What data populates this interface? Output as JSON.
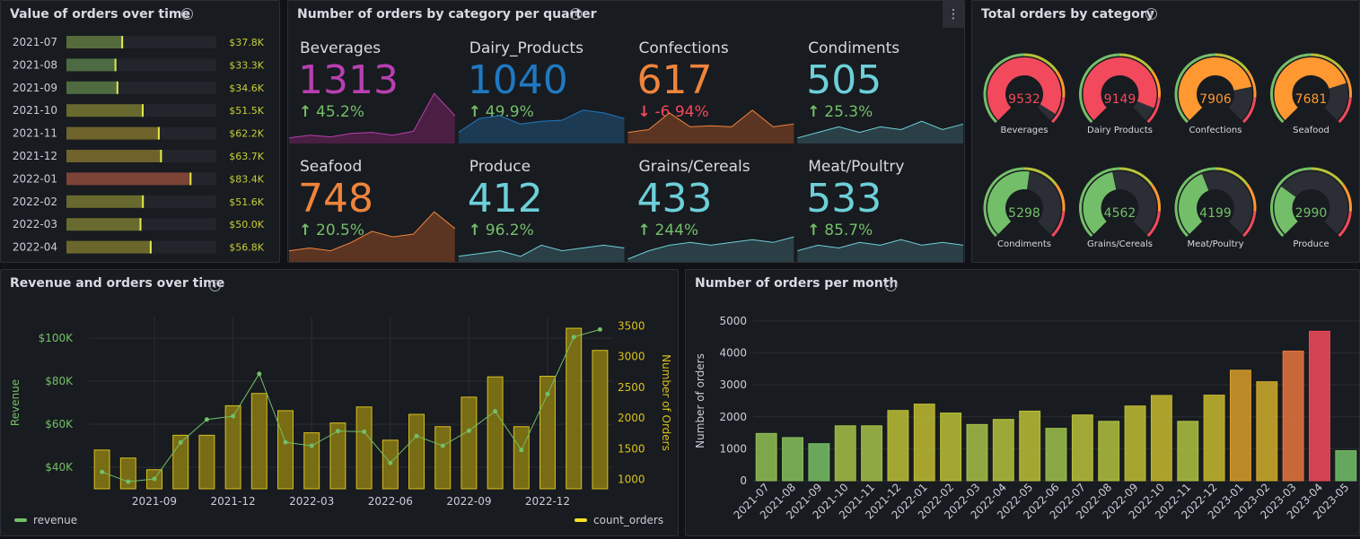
{
  "colors": {
    "green": "#73bf69",
    "yellow": "#fade2a",
    "orange": "#ff9830",
    "red": "#f2495c",
    "gold": "#b8a21c"
  },
  "panel1": {
    "title": "Value of orders over time",
    "rows": [
      {
        "label": "2021-07",
        "value": "$37.8K",
        "num": 37.8
      },
      {
        "label": "2021-08",
        "value": "$33.3K",
        "num": 33.3
      },
      {
        "label": "2021-09",
        "value": "$34.6K",
        "num": 34.6
      },
      {
        "label": "2021-10",
        "value": "$51.5K",
        "num": 51.5
      },
      {
        "label": "2021-11",
        "value": "$62.2K",
        "num": 62.2
      },
      {
        "label": "2021-12",
        "value": "$63.7K",
        "num": 63.7
      },
      {
        "label": "2022-01",
        "value": "$83.4K",
        "num": 83.4
      },
      {
        "label": "2022-02",
        "value": "$51.6K",
        "num": 51.6
      },
      {
        "label": "2022-03",
        "value": "$50.0K",
        "num": 50.0
      },
      {
        "label": "2022-04",
        "value": "$56.8K",
        "num": 56.8
      }
    ]
  },
  "panel2": {
    "title": "Number of orders by category per quarter",
    "stats": [
      {
        "name": "Beverages",
        "value": "1313",
        "change": "45.2%",
        "dir": "up",
        "color": "#b83fb0",
        "fill": "#4a1f43",
        "spark": [
          0.1,
          0.15,
          0.12,
          0.18,
          0.2,
          0.15,
          0.22,
          0.9,
          0.5
        ]
      },
      {
        "name": "Dairy_Products",
        "value": "1040",
        "change": "49.9%",
        "dir": "up",
        "color": "#1f78c1",
        "fill": "#1c3a52",
        "spark": [
          0.2,
          0.45,
          0.5,
          0.35,
          0.4,
          0.42,
          0.6,
          0.55,
          0.45
        ]
      },
      {
        "name": "Confections",
        "value": "617",
        "change": "-6.94%",
        "dir": "down",
        "color": "#ef843c",
        "fill": "#5c3422",
        "spark": [
          0.2,
          0.25,
          0.55,
          0.3,
          0.32,
          0.3,
          0.6,
          0.3,
          0.35
        ]
      },
      {
        "name": "Condiments",
        "value": "505",
        "change": "25.3%",
        "dir": "up",
        "color": "#6ccfd9",
        "fill": "#2b3f47",
        "spark": [
          0.1,
          0.2,
          0.3,
          0.2,
          0.3,
          0.25,
          0.4,
          0.25,
          0.35
        ]
      },
      {
        "name": "Seafood",
        "value": "748",
        "change": "20.5%",
        "dir": "up",
        "color": "#ef843c",
        "fill": "#5c3422",
        "spark": [
          0.2,
          0.25,
          0.2,
          0.35,
          0.55,
          0.45,
          0.5,
          0.9,
          0.6
        ]
      },
      {
        "name": "Produce",
        "value": "412",
        "change": "96.2%",
        "dir": "up",
        "color": "#6ccfd9",
        "fill": "#2b3f47",
        "spark": [
          0.1,
          0.15,
          0.2,
          0.1,
          0.3,
          0.2,
          0.25,
          0.3,
          0.25
        ]
      },
      {
        "name": "Grains/Cereals",
        "value": "433",
        "change": "244%",
        "dir": "up",
        "color": "#6ccfd9",
        "fill": "#2b3f47",
        "spark": [
          0.05,
          0.2,
          0.3,
          0.35,
          0.3,
          0.35,
          0.4,
          0.35,
          0.45
        ]
      },
      {
        "name": "Meat/Poultry",
        "value": "533",
        "change": "85.7%",
        "dir": "up",
        "color": "#6ccfd9",
        "fill": "#2b3f47",
        "spark": [
          0.2,
          0.3,
          0.25,
          0.35,
          0.3,
          0.4,
          0.3,
          0.35,
          0.3
        ]
      }
    ],
    "menu_icon": "kebab-menu-icon"
  },
  "panel3": {
    "title": "Total orders by category",
    "max": 10000,
    "gauges": [
      {
        "value": "9532",
        "num": 9532,
        "label": "Beverages",
        "color": "#f2495c"
      },
      {
        "value": "9149",
        "num": 9149,
        "label": "Dairy Products",
        "color": "#f2495c"
      },
      {
        "value": "7906",
        "num": 7906,
        "label": "Confections",
        "color": "#ff9830"
      },
      {
        "value": "7681",
        "num": 7681,
        "label": "Seafood",
        "color": "#ff9830"
      },
      {
        "value": "5298",
        "num": 5298,
        "label": "Condiments",
        "color": "#73bf69"
      },
      {
        "value": "4562",
        "num": 4562,
        "label": "Grains/Cereals",
        "color": "#73bf69"
      },
      {
        "value": "4199",
        "num": 4199,
        "label": "Meat/Poultry",
        "color": "#73bf69"
      },
      {
        "value": "2990",
        "num": 2990,
        "label": "Produce",
        "color": "#73bf69"
      }
    ]
  },
  "panel4": {
    "title": "Revenue and orders over time",
    "ylabel_left": "Revenue",
    "ylabel_right": "Number of Orders",
    "left_ticks": [
      "$40K",
      "$60K",
      "$80K",
      "$100K"
    ],
    "left_tick_values": [
      40,
      60,
      80,
      100
    ],
    "right_ticks": [
      "1000",
      "1500",
      "2000",
      "2500",
      "3000",
      "3500"
    ],
    "right_tick_values": [
      1000,
      1500,
      2000,
      2500,
      3000,
      3500
    ],
    "x_ticks": [
      "2021-09",
      "2021-12",
      "2022-03",
      "2022-06",
      "2022-09",
      "2022-12"
    ],
    "legend_revenue": "revenue",
    "legend_orders": "count_orders"
  },
  "panel5": {
    "title": "Number of orders per month",
    "ylabel": "Number of orders",
    "y_ticks": [
      "0",
      "1000",
      "2000",
      "3000",
      "4000",
      "5000"
    ]
  },
  "chart_data": [
    {
      "type": "bar",
      "title": "Revenue and orders over time",
      "ylabel": "Revenue",
      "y2label": "Number of Orders",
      "ylim": [
        30,
        110
      ],
      "y2lim": [
        850,
        3650
      ],
      "x_ticks": [
        "2021-09",
        "2021-12",
        "2022-03",
        "2022-06",
        "2022-09",
        "2022-12"
      ],
      "series": [
        {
          "name": "revenue",
          "type": "line",
          "values": [
            37.8,
            33.3,
            34.6,
            51.5,
            62.2,
            63.7,
            83.4,
            51.6,
            50.0,
            56.8,
            56.5,
            42.0,
            54.5,
            50.0,
            57.0,
            66.0,
            48.0,
            74.0,
            100.5,
            104.0
          ]
        },
        {
          "name": "count_orders",
          "type": "bar",
          "values": [
            1480,
            1350,
            1160,
            1720,
            1720,
            2200,
            2400,
            2120,
            1760,
            1920,
            2180,
            1640,
            2060,
            1860,
            2340,
            2670,
            1860,
            2680,
            3460,
            3100
          ]
        }
      ]
    },
    {
      "type": "bar",
      "title": "Number of orders per month",
      "ylabel": "Number of orders",
      "ylim": [
        0,
        5000
      ],
      "categories": [
        "2021-07",
        "2021-08",
        "2021-09",
        "2021-10",
        "2021-11",
        "2021-12",
        "2022-01",
        "2022-02",
        "2022-03",
        "2022-04",
        "2022-05",
        "2022-06",
        "2022-07",
        "2022-08",
        "2022-09",
        "2022-10",
        "2022-11",
        "2022-12",
        "2023-01",
        "2023-02",
        "2023-03",
        "2023-04",
        "2023-05"
      ],
      "values": [
        1480,
        1350,
        1160,
        1720,
        1720,
        2200,
        2400,
        2120,
        1760,
        1920,
        2180,
        1640,
        2060,
        1860,
        2340,
        2670,
        1860,
        2680,
        3460,
        3100,
        4060,
        4680,
        940
      ]
    }
  ]
}
